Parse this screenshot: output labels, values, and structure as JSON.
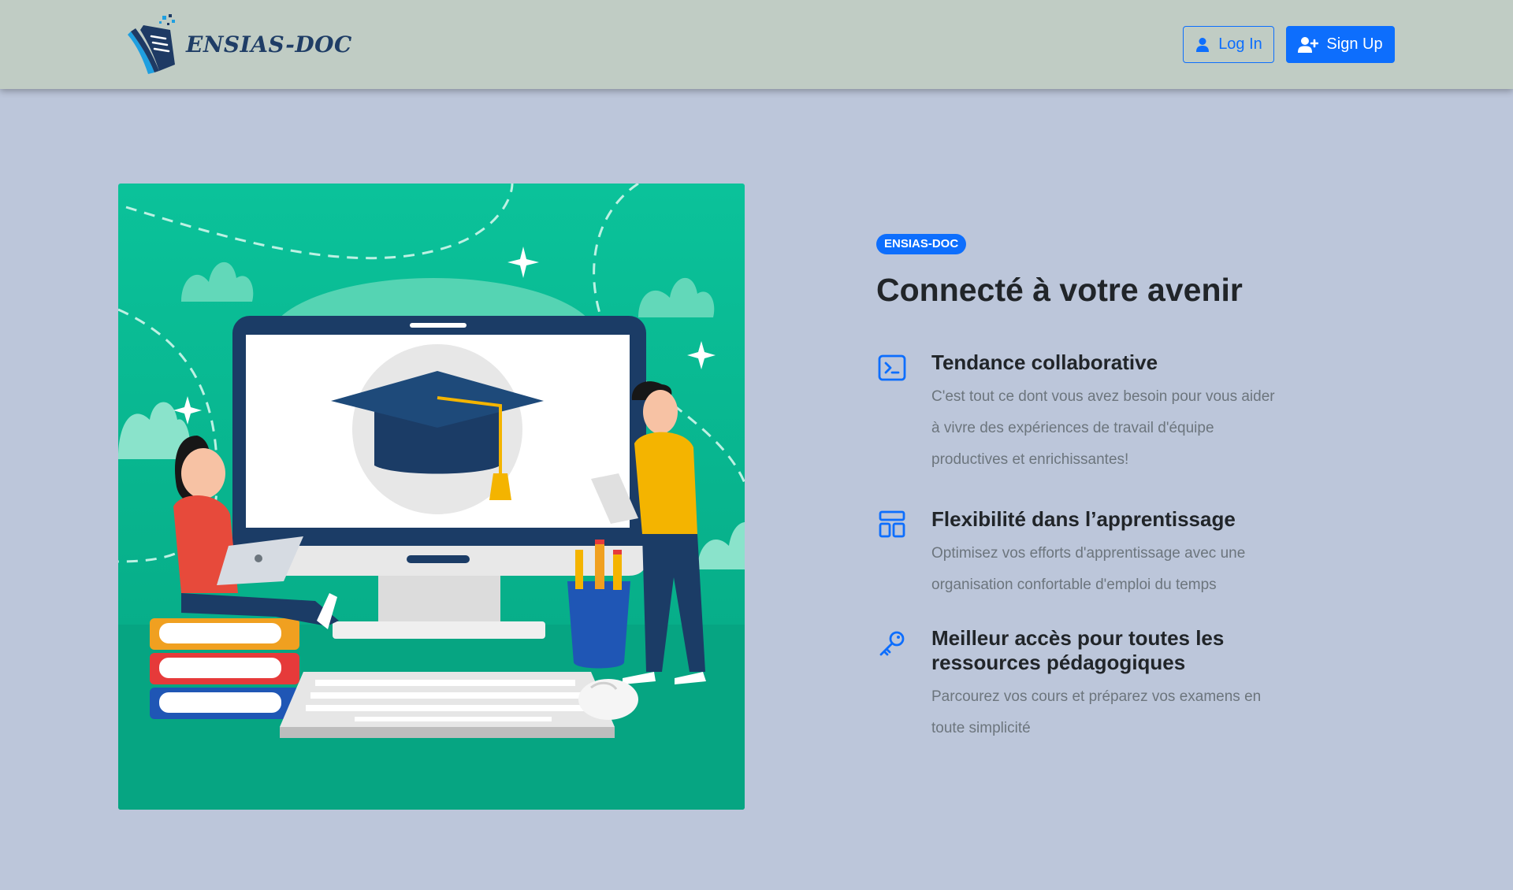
{
  "header": {
    "brand_name": "ENSIAS-DOC",
    "login_label": "Log In",
    "signup_label": "Sign Up"
  },
  "hero": {
    "badge": "ENSIAS-DOC",
    "headline": "Connecté à votre avenir",
    "illustration": "students-graduation-cap-computer-illustration"
  },
  "features": [
    {
      "icon": "terminal-icon",
      "title": "Tendance collaborative",
      "text": "C'est tout ce dont vous avez besoin pour vous aider à vivre des expériences de travail d'équipe productives et enrichissantes!"
    },
    {
      "icon": "layout-icon",
      "title": "Flexibilité dans l’apprentissage",
      "text": "Optimisez vos efforts d'apprentissage avec une organisation confortable d'emploi du temps"
    },
    {
      "icon": "key-icon",
      "title": "Meilleur accès pour toutes les ressources pédagogiques",
      "text": "Parcourez vos cours et préparez vos examens en toute simplicité"
    }
  ],
  "colors": {
    "page_background": "#bcc6da",
    "header_background": "#c0ccc4",
    "primary": "#0d6efd",
    "illustration_green": "#0bbf97"
  }
}
